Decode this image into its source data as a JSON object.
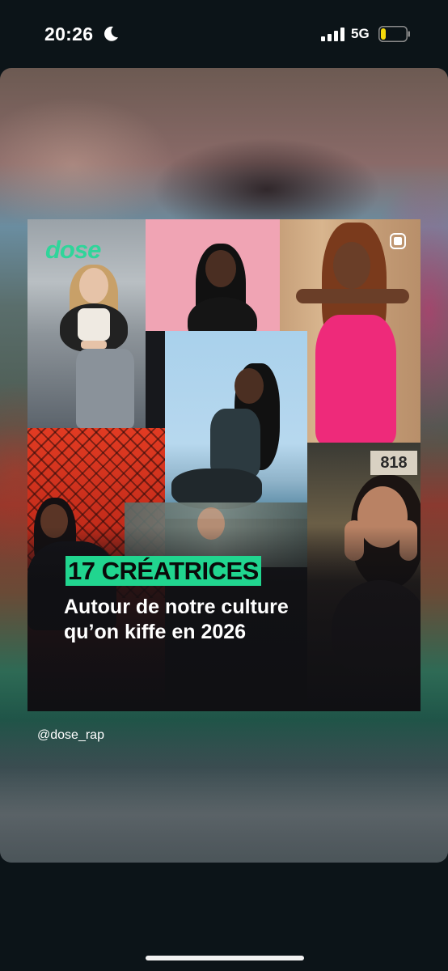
{
  "status_bar": {
    "time": "20:26",
    "network": "5G",
    "battery_level": 0.2,
    "battery_color": "#f5d90a",
    "icons": [
      "moon-icon",
      "signal-icon",
      "battery-icon"
    ]
  },
  "story": {
    "post": {
      "brand": "dose",
      "brand_color": "#2fd59a",
      "headline": "17 CRÉATRICES",
      "headline_bg": "#21d58f",
      "subtitle_line1": "Autour de notre culture",
      "subtitle_line2": "qu’on kiffe en 2026",
      "corner_sign": "818"
    },
    "handle": "@dose_rap"
  }
}
